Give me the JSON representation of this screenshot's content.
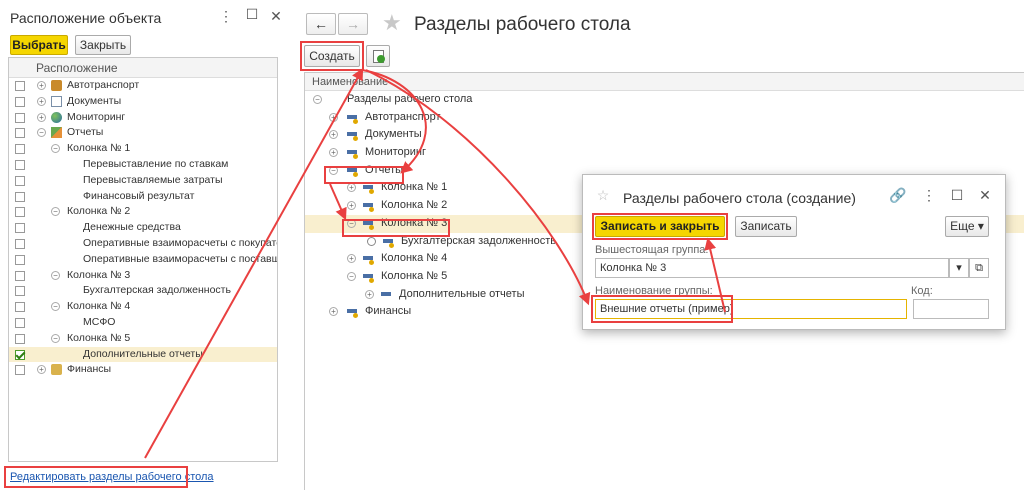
{
  "left_panel": {
    "title": "Расположение объекта",
    "select_label": "Выбрать",
    "close_label": "Закрыть",
    "column_header": "Расположение",
    "rows": [
      {
        "label": "Автотранспорт",
        "icon": "bus-icon"
      },
      {
        "label": "Документы",
        "icon": "document-icon"
      },
      {
        "label": "Мониторинг",
        "icon": "globe-icon"
      },
      {
        "label": "Отчеты",
        "icon": "chart-icon"
      },
      {
        "label": "Колонка № 1"
      },
      {
        "label": "Перевыставление по ставкам"
      },
      {
        "label": "Перевыставляемые затраты"
      },
      {
        "label": "Финансовый результат"
      },
      {
        "label": "Колонка № 2"
      },
      {
        "label": "Денежные средства"
      },
      {
        "label": "Оперативные взаиморасчеты с покупател..."
      },
      {
        "label": "Оперативные взаиморасчеты с поставщи..."
      },
      {
        "label": "Колонка № 3"
      },
      {
        "label": "Бухгалтерская задолженность"
      },
      {
        "label": "Колонка № 4"
      },
      {
        "label": "МСФО"
      },
      {
        "label": "Колонка № 5"
      },
      {
        "label": "Дополнительные отчеты",
        "checked": true
      },
      {
        "label": "Финансы",
        "icon": "finance-icon"
      }
    ],
    "edit_link": "Редактировать разделы рабочего стола"
  },
  "main": {
    "back_icon": "←",
    "forward_icon": "→",
    "title": "Разделы рабочего стола",
    "create_label": "Создать",
    "column_header": "Наименование",
    "rows": [
      {
        "label": "Разделы рабочего стола"
      },
      {
        "label": "Автотранспорт"
      },
      {
        "label": "Документы"
      },
      {
        "label": "Мониторинг"
      },
      {
        "label": "Отчеты"
      },
      {
        "label": "Колонка № 1"
      },
      {
        "label": "Колонка № 2"
      },
      {
        "label": "Колонка № 3"
      },
      {
        "label": "Бухгалтерская задолженность"
      },
      {
        "label": "Колонка № 4"
      },
      {
        "label": "Колонка № 5"
      },
      {
        "label": "Дополнительные отчеты"
      },
      {
        "label": "Финансы"
      }
    ]
  },
  "dialog": {
    "title": "Разделы рабочего стола (создание)",
    "save_close_label": "Записать и закрыть",
    "save_label": "Записать",
    "more_label": "Еще",
    "parent_label": "Вышестоящая группа:",
    "parent_value": "Колонка № 3",
    "name_label": "Наименование группы:",
    "name_value": "Внешние отчеты (пример)",
    "code_label": "Код:",
    "code_value": ""
  },
  "colors": {
    "accent_yellow": "#f5d600",
    "highlight_red": "#e94040",
    "link_blue": "#1a56b0"
  }
}
